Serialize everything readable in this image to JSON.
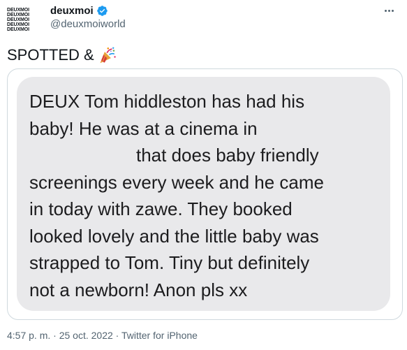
{
  "author": {
    "display_name": "deuxmoi",
    "handle": "@deuxmoiworld",
    "avatar_lines": [
      "DEUXMOI",
      "DEUXMOI",
      "DEUXMOI",
      "DEUXMOI",
      "DEUXMOI"
    ],
    "verified": true
  },
  "tweet": {
    "text": "SPOTTED &",
    "emoji_icon": "party-popper-icon"
  },
  "message": {
    "lines": [
      "DEUX Tom hiddleston has had his",
      "baby! He was at a cinema in",
      "that does baby friendly",
      "screenings every week and he came",
      "in today with zawe. They booked",
      "looked lovely and the little baby was",
      "strapped to Tom. Tiny but definitely",
      "not a newborn! Anon pls xx"
    ]
  },
  "meta": {
    "time": "4:57 p. m.",
    "separator": "·",
    "date": "25 oct. 2022",
    "source": "Twitter for iPhone"
  },
  "colors": {
    "verified": "#1d9bf0",
    "bubble": "#e9e9eb",
    "muted": "#536471",
    "border": "#cfd9de"
  }
}
